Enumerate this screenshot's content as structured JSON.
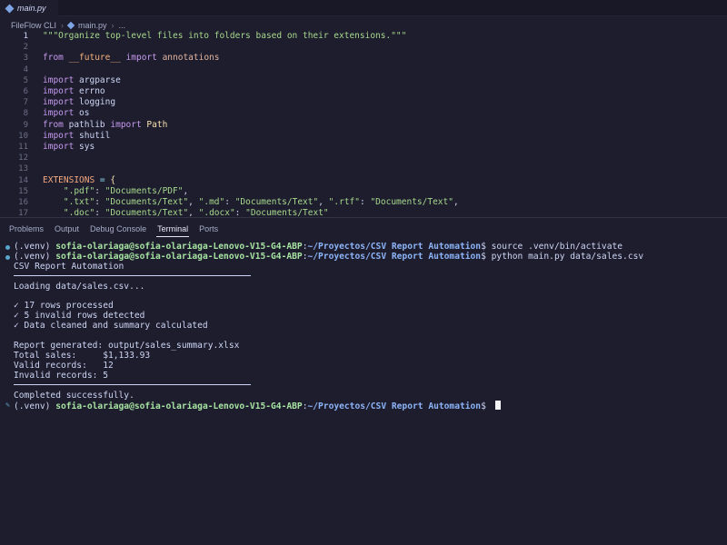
{
  "tab": {
    "label": "main.py",
    "icon": "python-file-icon"
  },
  "breadcrumb": {
    "folder": "FileFlow CLI",
    "file": "main.py",
    "more": "..."
  },
  "editor": {
    "lines": [
      {
        "n": "1",
        "segs": [
          {
            "t": "\"\"\"Organize top-level files into folders based on their extensions.\"\"\"",
            "c": "str"
          }
        ]
      },
      {
        "n": "2",
        "segs": []
      },
      {
        "n": "3",
        "segs": [
          {
            "t": "from ",
            "c": "kw"
          },
          {
            "t": "__future__",
            "c": "dund"
          },
          {
            "t": " import ",
            "c": "kw"
          },
          {
            "t": "annotations",
            "c": "mod"
          }
        ]
      },
      {
        "n": "4",
        "segs": []
      },
      {
        "n": "5",
        "segs": [
          {
            "t": "import ",
            "c": "kw"
          },
          {
            "t": "argparse",
            "c": "pl"
          }
        ]
      },
      {
        "n": "6",
        "segs": [
          {
            "t": "import ",
            "c": "kw"
          },
          {
            "t": "errno",
            "c": "pl"
          }
        ]
      },
      {
        "n": "7",
        "segs": [
          {
            "t": "import ",
            "c": "kw"
          },
          {
            "t": "logging",
            "c": "pl"
          }
        ]
      },
      {
        "n": "8",
        "segs": [
          {
            "t": "import ",
            "c": "kw"
          },
          {
            "t": "os",
            "c": "pl"
          }
        ]
      },
      {
        "n": "9",
        "segs": [
          {
            "t": "from ",
            "c": "kw"
          },
          {
            "t": "pathlib ",
            "c": "pl"
          },
          {
            "t": "import ",
            "c": "kw"
          },
          {
            "t": "Path",
            "c": "brace"
          }
        ]
      },
      {
        "n": "10",
        "segs": [
          {
            "t": "import ",
            "c": "kw"
          },
          {
            "t": "shutil",
            "c": "pl"
          }
        ]
      },
      {
        "n": "11",
        "segs": [
          {
            "t": "import ",
            "c": "kw"
          },
          {
            "t": "sys",
            "c": "pl"
          }
        ]
      },
      {
        "n": "12",
        "segs": []
      },
      {
        "n": "13",
        "segs": []
      },
      {
        "n": "14",
        "segs": [
          {
            "t": "EXTENSIONS",
            "c": "cst"
          },
          {
            "t": " = ",
            "c": "op"
          },
          {
            "t": "{",
            "c": "brace"
          }
        ]
      },
      {
        "n": "15",
        "segs": [
          {
            "t": "    \".pdf\"",
            "c": "str"
          },
          {
            "t": ": ",
            "c": "pl"
          },
          {
            "t": "\"Documents/PDF\"",
            "c": "str"
          },
          {
            "t": ",",
            "c": "pl"
          }
        ]
      },
      {
        "n": "16",
        "segs": [
          {
            "t": "    \".txt\"",
            "c": "str"
          },
          {
            "t": ": ",
            "c": "pl"
          },
          {
            "t": "\"Documents/Text\"",
            "c": "str"
          },
          {
            "t": ", ",
            "c": "pl"
          },
          {
            "t": "\".md\"",
            "c": "str"
          },
          {
            "t": ": ",
            "c": "pl"
          },
          {
            "t": "\"Documents/Text\"",
            "c": "str"
          },
          {
            "t": ", ",
            "c": "pl"
          },
          {
            "t": "\".rtf\"",
            "c": "str"
          },
          {
            "t": ": ",
            "c": "pl"
          },
          {
            "t": "\"Documents/Text\"",
            "c": "str"
          },
          {
            "t": ",",
            "c": "pl"
          }
        ]
      },
      {
        "n": "17",
        "segs": [
          {
            "t": "    \".doc\"",
            "c": "str"
          },
          {
            "t": ": ",
            "c": "pl"
          },
          {
            "t": "\"Documents/Text\"",
            "c": "str"
          },
          {
            "t": ", ",
            "c": "pl"
          },
          {
            "t": "\".docx\"",
            "c": "str"
          },
          {
            "t": ": ",
            "c": "pl"
          },
          {
            "t": "\"Documents/Text\"",
            "c": "str"
          }
        ]
      }
    ],
    "active_line": "1"
  },
  "panel": {
    "tabs": [
      "Problems",
      "Output",
      "Debug Console",
      "Terminal",
      "Ports"
    ],
    "active_tab": "Terminal"
  },
  "terminal": {
    "prompt_env": "(.venv) ",
    "prompt_user": "sofia-olariaga@sofia-olariaga-Lenovo-V15-G4-ABP",
    "prompt_sep": ":",
    "prompt_path": "~/Proyectos/CSV Report Automation",
    "prompt_end": "$ ",
    "cmd1": "source .venv/bin/activate",
    "cmd2": "python main.py data/sales.csv",
    "out_title": "CSV Report Automation",
    "out_loading": "Loading data/sales.csv...",
    "out_check1": "✓ 17 rows processed",
    "out_check2": "✓ 5 invalid rows detected",
    "out_check3": "✓ Data cleaned and summary calculated",
    "out_report": "Report generated: output/sales_summary.xlsx",
    "out_total": "Total sales:     $1,133.93",
    "out_valid": "Valid records:   12",
    "out_invalid": "Invalid records: 5",
    "out_done": "Completed successfully."
  },
  "colors": {
    "accent_blue": "#59a6cc",
    "prompt_green": "#a6e3a1",
    "prompt_path": "#8cb4f8",
    "background": "#1e1d2e"
  }
}
